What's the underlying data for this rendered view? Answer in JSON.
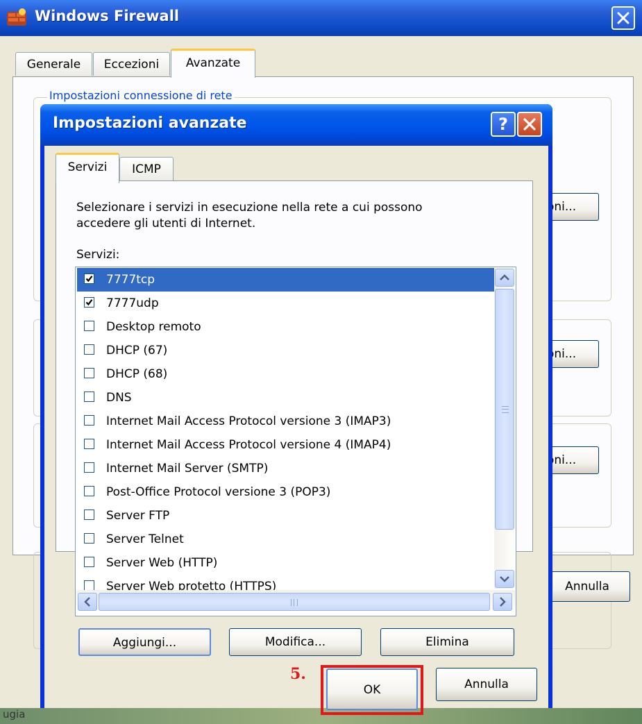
{
  "outer_window": {
    "title": "Windows Firewall",
    "tabs": [
      "Generale",
      "Eccezioni",
      "Avanzate"
    ],
    "active_tab": "Avanzate",
    "group_label": "Impostazioni connessione di rete",
    "side_buttons": [
      "oni...",
      "oni...",
      "oni...",
      "na"
    ],
    "cancel_label": "Annulla",
    "bottom_left_text": "ugia"
  },
  "dialog": {
    "title": "Impostazioni avanzate",
    "help_label": "?",
    "tabs": [
      "Servizi",
      "ICMP"
    ],
    "active_tab": "Servizi",
    "description": "Selezionare i servizi in esecuzione nella rete a cui possono accedere gli utenti di Internet.",
    "description_line1": "Selezionare i servizi in esecuzione nella rete a cui possono",
    "description_line2": "accedere gli utenti di Internet.",
    "services_label": "Servizi:",
    "services": [
      {
        "label": "7777tcp",
        "checked": true,
        "selected": true
      },
      {
        "label": "7777udp",
        "checked": true,
        "selected": false
      },
      {
        "label": "Desktop remoto",
        "checked": false,
        "selected": false
      },
      {
        "label": "DHCP (67)",
        "checked": false,
        "selected": false
      },
      {
        "label": "DHCP (68)",
        "checked": false,
        "selected": false
      },
      {
        "label": "DNS",
        "checked": false,
        "selected": false
      },
      {
        "label": "Internet Mail Access Protocol versione 3 (IMAP3)",
        "checked": false,
        "selected": false
      },
      {
        "label": "Internet Mail Access Protocol versione 4 (IMAP4)",
        "checked": false,
        "selected": false
      },
      {
        "label": "Internet Mail Server (SMTP)",
        "checked": false,
        "selected": false
      },
      {
        "label": "Post-Office Protocol versione 3 (POP3)",
        "checked": false,
        "selected": false
      },
      {
        "label": "Server FTP",
        "checked": false,
        "selected": false
      },
      {
        "label": "Server Telnet",
        "checked": false,
        "selected": false
      },
      {
        "label": "Server Web (HTTP)",
        "checked": false,
        "selected": false
      },
      {
        "label": "Server Web protetto (HTTPS)",
        "checked": false,
        "selected": false
      }
    ],
    "buttons": {
      "add": "Aggiungi...",
      "edit": "Modifica...",
      "delete": "Elimina",
      "ok": "OK",
      "cancel": "Annulla"
    },
    "step_annotation": "5.",
    "highlight_color": "#E01818"
  },
  "colors": {
    "titlebar_blue": "#0055EA",
    "selection_blue": "#316AC5",
    "dialog_face": "#ECE9D8",
    "active_tab_accent": "#FFC83C"
  },
  "icons": [
    "firewall-app-icon",
    "close-icon",
    "help-icon",
    "checkbox-icon",
    "scroll-up-icon",
    "scroll-down-icon",
    "scroll-left-icon",
    "scroll-right-icon"
  ]
}
